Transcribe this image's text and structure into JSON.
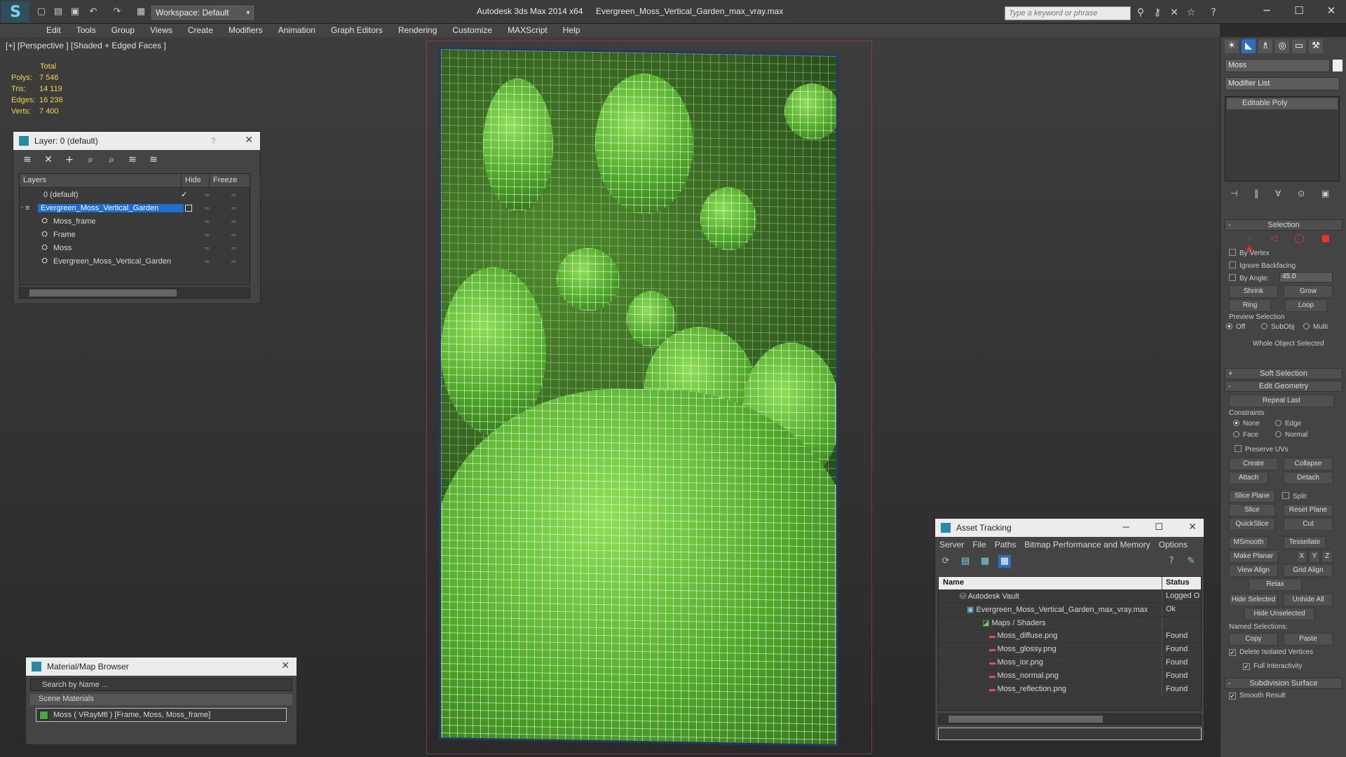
{
  "title": {
    "app": "Autodesk 3ds Max  2014 x64",
    "file": "Evergreen_Moss_Vertical_Garden_max_vray.max",
    "workspace": "Workspace: Default",
    "search_placeholder": "Type a keyword or phrase"
  },
  "menu": [
    "Edit",
    "Tools",
    "Group",
    "Views",
    "Create",
    "Modifiers",
    "Animation",
    "Graph Editors",
    "Rendering",
    "Customize",
    "MAXScript",
    "Help"
  ],
  "viewport": {
    "label": "[+] [Perspective ] [Shaded + Edged Faces ]",
    "stats": {
      "header": "Total",
      "rows": [
        {
          "k": "Polys:",
          "v": "7 546"
        },
        {
          "k": "Tris:",
          "v": "14 119"
        },
        {
          "k": "Edges:",
          "v": "16 238"
        },
        {
          "k": "Verts:",
          "v": "7 400"
        }
      ]
    }
  },
  "layer": {
    "title": "Layer: 0 (default)",
    "help": "?",
    "col_layers": "Layers",
    "col_hide": "Hide",
    "col_freeze": "Freeze",
    "rows": [
      {
        "name": "0 (default)",
        "indent": 1
      },
      {
        "name": "Evergreen_Moss_Vertical_Garden",
        "indent": 1,
        "selected": true
      },
      {
        "name": "Moss_frame",
        "indent": 2
      },
      {
        "name": "Frame",
        "indent": 2
      },
      {
        "name": "Moss",
        "indent": 2
      },
      {
        "name": "Evergreen_Moss_Vertical_Garden",
        "indent": 2
      }
    ]
  },
  "material": {
    "title": "Material/Map Browser",
    "search": "Search by Name ...",
    "section": "Scene Materials",
    "item": "Moss  ( VRayMtl ) [Frame, Moss, Moss_frame]"
  },
  "asset": {
    "title": "Asset Tracking",
    "menu": [
      "Server",
      "File",
      "Paths",
      "Bitmap Performance and Memory",
      "Options"
    ],
    "col_name": "Name",
    "col_status": "Status",
    "rows": [
      {
        "name": "Autodesk Vault",
        "status": "Logged O",
        "indent": 1
      },
      {
        "name": "Evergreen_Moss_Vertical_Garden_max_vray.max",
        "status": "Ok",
        "indent": 2
      },
      {
        "name": "Maps / Shaders",
        "status": "",
        "indent": 3
      },
      {
        "name": "Moss_diffuse.png",
        "status": "Found",
        "indent": 4
      },
      {
        "name": "Moss_glossy.png",
        "status": "Found",
        "indent": 4
      },
      {
        "name": "Moss_ior.png",
        "status": "Found",
        "indent": 4
      },
      {
        "name": "Moss_normal.png",
        "status": "Found",
        "indent": 4
      },
      {
        "name": "Moss_reflection.png",
        "status": "Found",
        "indent": 4
      }
    ]
  },
  "cmd": {
    "object_name": "Moss",
    "modifier_list": "Modifier List",
    "stack_item": "Editable Poly",
    "selection": "Selection",
    "by_vertex": "By Vertex",
    "ignore_backfacing": "Ignore Backfacing",
    "by_angle": "By Angle:",
    "angle": "45.0",
    "shrink": "Shrink",
    "grow": "Grow",
    "ring": "Ring",
    "loop": "Loop",
    "preview_selection": "Preview Selection",
    "off": "Off",
    "subobj": "SubObj",
    "multi": "Multi",
    "whole_object": "Whole Object Selected",
    "soft_selection": "Soft Selection",
    "edit_geometry": "Edit Geometry",
    "repeat_last": "Repeat Last",
    "constraints": "Constraints",
    "none": "None",
    "edge": "Edge",
    "face": "Face",
    "normal": "Normal",
    "preserve_uvs": "Preserve UVs",
    "create": "Create",
    "collapse": "Collapse",
    "attach": "Attach",
    "detach": "Detach",
    "slice_plane": "Slice Plane",
    "split": "Split",
    "slice": "Slice",
    "reset_plane": "Reset Plane",
    "quickslice": "QuickSlice",
    "cut": "Cut",
    "msmooth": "MSmooth",
    "tessellate": "Tessellate",
    "make_planar": "Make Planar",
    "x": "X",
    "y": "Y",
    "z": "Z",
    "view_align": "View Align",
    "grid_align": "Grid Align",
    "relax": "Relax",
    "hide_selected": "Hide Selected",
    "unhide_all": "Unhide All",
    "hide_unselected": "Hide Unselected",
    "named_selections": "Named Selections:",
    "copy": "Copy",
    "paste": "Paste",
    "delete_isolated": "Delete Isolated Vertices",
    "full_interactivity": "Full Interactivity",
    "subdivision_surface": "Subdivision Surface",
    "smooth_result": "Smooth Result"
  }
}
